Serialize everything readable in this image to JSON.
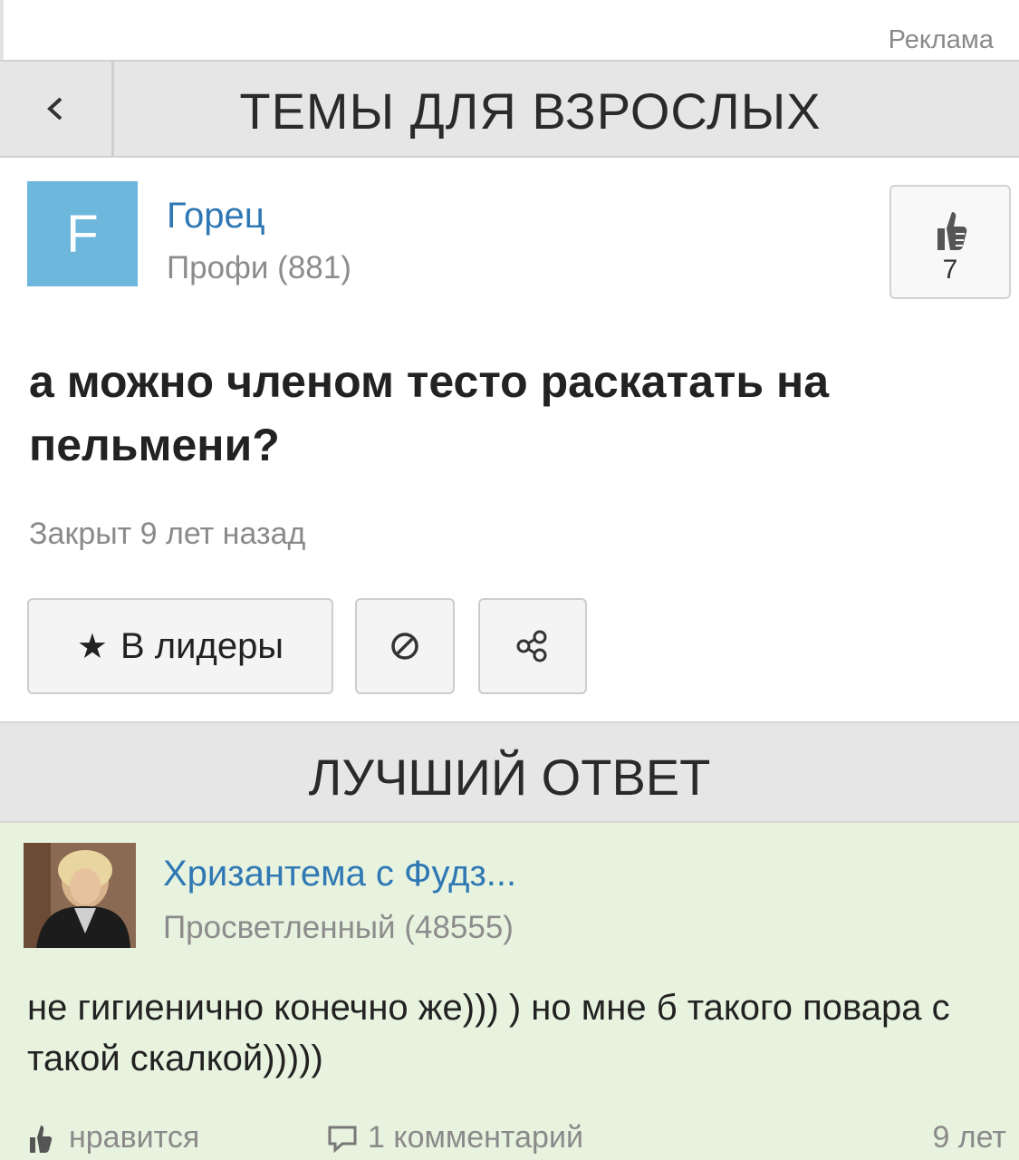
{
  "ad": {
    "label": "Реклама"
  },
  "header": {
    "title": "ТЕМЫ ДЛЯ ВЗРОСЛЫХ",
    "back_icon": "chevron-left-icon"
  },
  "question": {
    "avatar_letter": "F",
    "avatar_color": "#6db7dd",
    "author_name": "Горец",
    "author_rank": "Профи (881)",
    "likes": "7",
    "title": "а можно членом тесто раскатать на пельмени?",
    "status": "Закрыт 9 лет назад"
  },
  "actions": {
    "leaders_label": "В лидеры",
    "leaders_icon": "star-icon",
    "block_icon": "block-icon",
    "share_icon": "share-icon"
  },
  "best_answer": {
    "section_title": "ЛУЧШИЙ ОТВЕТ",
    "author_name": "Хризантема с Фудз...",
    "author_rank": "Просветленный (48555)",
    "text": "не гигиенично конечно же))) ) но мне б такого повара с такой скалкой)))))",
    "like_label": "нравится",
    "comments_label": "1 комментарий",
    "time": "9 лет",
    "background_color": "#e8f3df"
  },
  "colors": {
    "link": "#2f78b4",
    "muted": "#8a8a8a",
    "header_bg": "#e6e6e6"
  }
}
